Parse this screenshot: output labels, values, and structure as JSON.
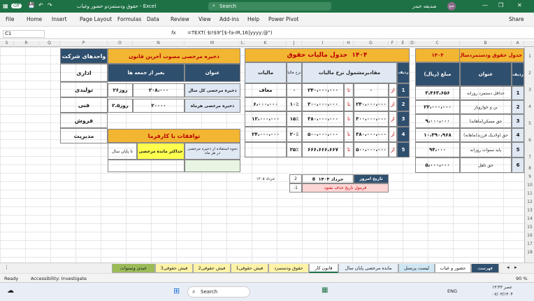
{
  "window": {
    "title": "حقوق ودستمزدو حضور وغیاب  -  Excel",
    "search": "Search",
    "user": "صدیقه حیدر",
    "user_initials": "صح"
  },
  "menu": [
    "File",
    "Home",
    "Insert",
    "Page Layout",
    "Formulas",
    "Data",
    "Review",
    "View",
    "Add-ins",
    "Help",
    "Power Pivot"
  ],
  "share": "Share",
  "formula": {
    "namebox": "C1",
    "fx": "fx",
    "content": "=TEXT( $I!$9\"[$-fa-IR,16]yyyy;@\")"
  },
  "columns": [
    "S",
    "R",
    "Q",
    "P",
    "O",
    "N",
    "M",
    "L",
    "K",
    "J",
    "I",
    "H",
    "G",
    "F",
    "E",
    "D",
    "C",
    "B",
    "A"
  ],
  "rows": [
    "1",
    "2",
    "3",
    "4",
    "5",
    "6",
    "7",
    "8",
    "9",
    "10",
    "11",
    "12",
    "13",
    "14",
    "15",
    "16",
    "17",
    "18",
    "19",
    "20",
    "21",
    "22",
    "23",
    "24",
    "25"
  ],
  "salary": {
    "title": "جدول حقوق ودستمزدسال",
    "year": "۱۴۰۴",
    "h_row": "ردیف",
    "h_title": "عنوان",
    "h_amount": "مبلغ (ریال)",
    "rows": [
      {
        "n": "1",
        "title": "حداقل دستمزد روزانه",
        "amt": "۳،۴۶۳،۶۵۶"
      },
      {
        "n": "2",
        "title": "بن و خواروبار",
        "amt": "۲۲،۰۰۰،۰۰۰"
      },
      {
        "n": "3",
        "title": "حق مسکن(ماهانه)",
        "amt": "۹،۰۰۰،۰۰۰"
      },
      {
        "n": "4",
        "title": "حق اولادیک فرزند(ماهانه)",
        "amt": "۱۰،۳۹۰،۹۶۸"
      },
      {
        "n": "5",
        "title": "پایه سنوات روزانه",
        "amt": "۹۴،۰۰۰"
      },
      {
        "n": "6",
        "title": "حق تاهل",
        "amt": "۵،۰۰۰،۰۰۰"
      }
    ]
  },
  "tax": {
    "title": "جدول مالیات حقوق",
    "year": "۱۴۰۴",
    "h_row": "ردیف",
    "h_range": "مقادیرمشمول نرخ مالیات",
    "h_rate": "نرخ مالیا",
    "h_tax": "مالیات",
    "from": "از",
    "to": "تا",
    "rows": [
      {
        "n": "1",
        "from": "۰",
        "to": "۲۴۰،۰۰۰،۰۰۰",
        "rate": "۰",
        "tax": "معاف"
      },
      {
        "n": "2",
        "from": "۲۴۰،۰۰۰،۰۰۰",
        "to": "۳۰۰،۰۰۰،۰۰۰",
        "rate": "۱۰٪",
        "tax": "۶،۰۰۰،۰۰۰"
      },
      {
        "n": "3",
        "from": "۳۰۰،۰۰۰،۰۰۰",
        "to": "۳۸۰،۰۰۰،۰۰۰",
        "rate": "۱۵٪",
        "tax": "۱۲،۰۰۰،۰۰۰"
      },
      {
        "n": "4",
        "from": "۳۸۰،۰۰۰،۰۰۰",
        "to": "۵۰۰،۰۰۰،۰۰۰",
        "rate": "۲۰٪",
        "tax": "۲۴،۰۰۰،۰۰۰"
      },
      {
        "n": "5",
        "from": "۵۰۰،۰۰۰،۰۰۰",
        "to": "۶۶۶،۶۶۶،۶۶۷",
        "rate": "۲۵٪",
        "tax": ""
      }
    ]
  },
  "leave": {
    "title": "ذخیره مرخصی مصوب آخرین قانون",
    "h_title": "عنوان",
    "h_value": "بغیر از جمعه ها",
    "rows": [
      {
        "title": "ذخیره مرخصی کل سال",
        "v1": "۲۰۸،۰۰۰",
        "v2": "۲۶روز"
      },
      {
        "title": "ذخیره مرخصی هرماه",
        "v1": "۲۰۰۰۰",
        "v2": "۲.۵روز"
      }
    ]
  },
  "agree": {
    "title": "توافقات با کارفرما",
    "c1": "نحوه استفاده از ذخیره مرخصی در هر ماه",
    "c2": "حداکثر مانده مرخصی",
    "c3": "تا پایان سال"
  },
  "units": {
    "title": "واحدهای شرکت",
    "items": [
      "اداری",
      "تولیدی",
      "فنی",
      "فروش",
      "مدیریت"
    ]
  },
  "dates": {
    "label": "تاریخ امروز",
    "day": "8",
    "value": "خرداد ۱۴۰۳",
    "num": "2",
    "note": "فرمول تاریخ حذف نشود",
    "note_num": "-1",
    "aside": "خرداد ۱۴۰۵"
  },
  "tabs": [
    "فهرست",
    "حضور و غیاب",
    "لیست پرسنل",
    "مانده مرخصی پایان سال",
    "قانون کار",
    "حقوق ودستمزد",
    "فیش حقوقی1",
    "فیش حقوقی2",
    "فیش حقوقی3",
    "عیدی وسنوات"
  ],
  "status": {
    "ready": "Ready",
    "access": "Accessibility: Investigate",
    "zoom": "90 %"
  },
  "taskbar": {
    "search": "Search",
    "lang": "ENG",
    "time": "۱۳:۴۳ عصر",
    "date": "۰۷/۰۳/۱۴۰۴"
  }
}
